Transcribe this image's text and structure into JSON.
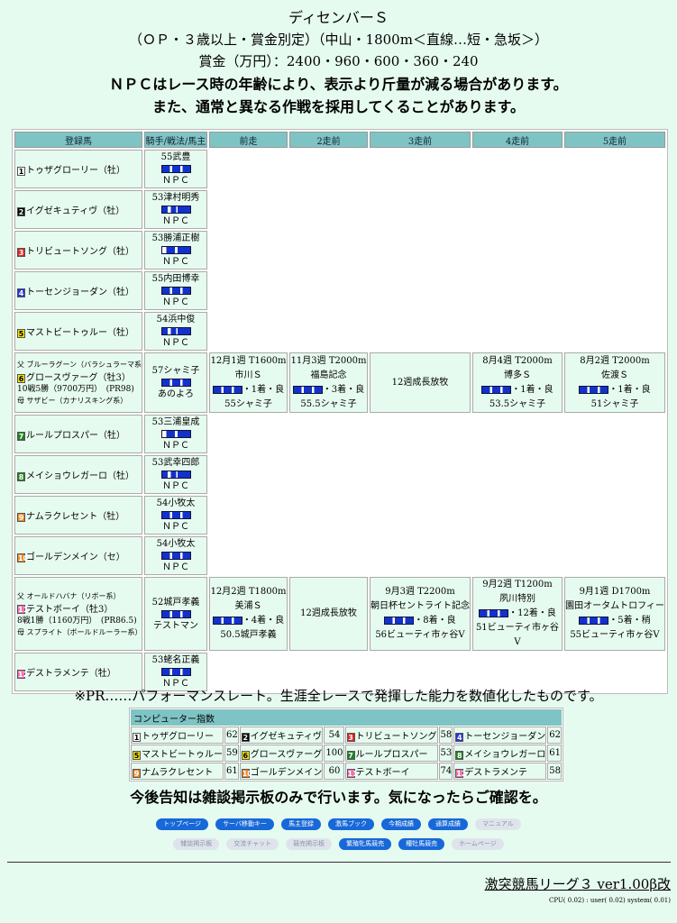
{
  "header": {
    "title": "ディセンバーＳ",
    "conditions": "（ＯＰ・３歳以上・賞金別定）（中山・1800m＜直線…短・急坂＞）",
    "prize": "賞金（万円）：2400・960・600・360・240",
    "note1": "ＮＰＣはレース時の年齢により、表示より斤量が減る場合があります。",
    "note2": "また、通常と異なる作戦を採用してくることがあります。"
  },
  "table": {
    "headers": [
      "登録馬",
      "騎手/戦法/馬主",
      "前走",
      "2走前",
      "3走前",
      "4走前",
      "5走前"
    ],
    "rows": [
      {
        "num": "1",
        "numbg": "#ffffff",
        "numfg": "#000",
        "name": "トゥザグローリー（牡）",
        "jockey": "55武豊",
        "owner": "ＮＰＣ"
      },
      {
        "num": "2",
        "numbg": "#000000",
        "numfg": "#fff",
        "name": "イグゼキュティヴ（牡）",
        "jockey": "53津村明秀",
        "owner": "ＮＰＣ"
      },
      {
        "num": "3",
        "numbg": "#e02020",
        "numfg": "#fff",
        "name": "トリビュートソング（牡）",
        "jockey": "53勝浦正樹",
        "owner": "ＮＰＣ"
      },
      {
        "num": "4",
        "numbg": "#2233dd",
        "numfg": "#fff",
        "name": "トーセンジョーダン（牡）",
        "jockey": "55内田博幸",
        "owner": "ＮＰＣ"
      },
      {
        "num": "5",
        "numbg": "#f5e000",
        "numfg": "#000",
        "name": "マストビートゥルー（牡）",
        "jockey": "54浜中俊",
        "owner": "ＮＰＣ"
      },
      {
        "num": "6",
        "numbg": "#f5e000",
        "numfg": "#000",
        "name": "グロースヴァーグ（牡3）",
        "sire": "父 ブルーラグーン（バラシュラーマ系）",
        "record": "10戦5勝（9700万円）　(PR98)",
        "dam": "母 サザビー（カナリスキング系）",
        "jockey": "57シャミ子",
        "owner": "あのよろ",
        "races": [
          {
            "l1": "12月1週 T1600m",
            "l2": "市川Ｓ",
            "l3": "・1着・良",
            "l4": "55シャミ子",
            "bg": "pink"
          },
          {
            "l1": "11月3週 T2000m",
            "l2": "福島記念",
            "l3": "・3着・良",
            "l4": "55.5シャミ子",
            "bg": "teal"
          },
          {
            "l1": "",
            "l2": "12週成長放牧",
            "l3": "",
            "l4": "",
            "bg": "white",
            "span": 1
          },
          {
            "l1": "8月4週 T2000m",
            "l2": "博多Ｓ",
            "l3": "・1着・良",
            "l4": "53.5シャミ子",
            "bg": "pink"
          },
          {
            "l1": "8月2週 T2000m",
            "l2": "佐渡Ｓ",
            "l3": "・1着・良",
            "l4": "51シャミ子",
            "bg": "pink"
          }
        ]
      },
      {
        "num": "7",
        "numbg": "#208020",
        "numfg": "#fff",
        "name": "ルールプロスパー（牡）",
        "jockey": "53三浦皇成",
        "owner": "ＮＰＣ"
      },
      {
        "num": "8",
        "numbg": "#208020",
        "numfg": "#fff",
        "name": "メイショウレガーロ（牡）",
        "jockey": "53武幸四郎",
        "owner": "ＮＰＣ"
      },
      {
        "num": "9",
        "numbg": "#f08a20",
        "numfg": "#fff",
        "name": "ナムラクレセント（牡）",
        "jockey": "54小牧太",
        "owner": "ＮＰＣ"
      },
      {
        "num": "10",
        "numbg": "#f08a20",
        "numfg": "#fff",
        "name": "ゴールデンメイン（セ）",
        "jockey": "54小牧太",
        "owner": "ＮＰＣ"
      },
      {
        "num": "11",
        "numbg": "#f36fb0",
        "numfg": "#fff",
        "name": "テストボーイ（牡3）",
        "sire": "父 オールドハバナ（リボー系）",
        "record": "8戦1勝（1160万円）　(PR86.5)",
        "dam": "母 スプライト（ボールドルーラー系）",
        "jockey": "52城戸孝義",
        "owner": "テストマン",
        "races": [
          {
            "l1": "12月2週 T1800m",
            "l2": "美浦Ｓ",
            "l3": "・4着・良",
            "l4": "50.5城戸孝義",
            "bg": "white"
          },
          {
            "l1": "",
            "l2": "12週成長放牧",
            "l3": "",
            "l4": "",
            "bg": "white"
          },
          {
            "l1": "9月3週 T2200m",
            "l2": "朝日杯セントライト記念",
            "l3": "・8着・良",
            "l4": "56ビューティ市ヶ谷V",
            "bg": "white"
          },
          {
            "l1": "9月2週 T1200m",
            "l2": "夙川特別",
            "l3": "・12着・良",
            "l4": "51ビューティ市ヶ谷V",
            "bg": "white"
          },
          {
            "l1": "9月1週 D1700m",
            "l2": "園田オータムトロフィー",
            "l3": "・5着・稍",
            "l4": "55ビューティ市ヶ谷V",
            "bg": "white"
          }
        ]
      },
      {
        "num": "12",
        "numbg": "#f36fb0",
        "numfg": "#fff",
        "name": "デストラメンテ（牡）",
        "jockey": "53蛯名正義",
        "owner": "ＮＰＣ"
      }
    ]
  },
  "pr_note": "※PR……パフォーマンスレート。生涯全レースで発揮した能力を数値化したものです。",
  "computer_index": {
    "title": "コンピューター指数",
    "rows": [
      [
        {
          "num": "1",
          "numbg": "#ffffff",
          "numfg": "#000",
          "name": "トゥザグローリー",
          "val": "62"
        },
        {
          "num": "2",
          "numbg": "#000000",
          "numfg": "#fff",
          "name": "イグゼキュティヴ",
          "val": "54"
        },
        {
          "num": "3",
          "numbg": "#e02020",
          "numfg": "#fff",
          "name": "トリビュートソング",
          "val": "58"
        },
        {
          "num": "4",
          "numbg": "#2233dd",
          "numfg": "#fff",
          "name": "トーセンジョーダン",
          "val": "62"
        }
      ],
      [
        {
          "num": "5",
          "numbg": "#f5e000",
          "numfg": "#000",
          "name": "マストビートゥルー",
          "val": "59"
        },
        {
          "num": "6",
          "numbg": "#f5e000",
          "numfg": "#000",
          "name": "グロースヴァーグ",
          "val": "100"
        },
        {
          "num": "7",
          "numbg": "#208020",
          "numfg": "#fff",
          "name": "ルールプロスパー",
          "val": "53"
        },
        {
          "num": "8",
          "numbg": "#208020",
          "numfg": "#fff",
          "name": "メイショウレガーロ",
          "val": "61"
        }
      ],
      [
        {
          "num": "9",
          "numbg": "#f08a20",
          "numfg": "#fff",
          "name": "ナムラクレセント",
          "val": "61"
        },
        {
          "num": "10",
          "numbg": "#f08a20",
          "numfg": "#fff",
          "name": "ゴールデンメイン",
          "val": "60"
        },
        {
          "num": "11",
          "numbg": "#f36fb0",
          "numfg": "#fff",
          "name": "テストボーイ",
          "val": "74"
        },
        {
          "num": "12",
          "numbg": "#f36fb0",
          "numfg": "#fff",
          "name": "デストラメンテ",
          "val": "58"
        }
      ]
    ]
  },
  "notice": "今後告知は雑談掲示板のみで行います。気になったらご確認を。",
  "nav1": [
    {
      "label": "トップページ",
      "active": true
    },
    {
      "label": "サーバ移動キー",
      "active": true
    },
    {
      "label": "馬主登録",
      "active": true
    },
    {
      "label": "激馬ブック",
      "active": true
    },
    {
      "label": "今期成績",
      "active": true
    },
    {
      "label": "通算成績",
      "active": true
    },
    {
      "label": "マニュアル",
      "active": false
    }
  ],
  "nav2": [
    {
      "label": "雑談掲示板",
      "active": false
    },
    {
      "label": "交流チャット",
      "active": false
    },
    {
      "label": "競売掲示板",
      "active": false
    },
    {
      "label": "繁殖牝馬競売",
      "active": true
    },
    {
      "label": "種牡馬競売",
      "active": true
    },
    {
      "label": "ホームページ",
      "active": false
    }
  ],
  "footer": {
    "version": "激突競馬リーグ３ ver1.00β改",
    "cpu": "CPU( 0.02) : user( 0.02) system( 0.01)"
  }
}
